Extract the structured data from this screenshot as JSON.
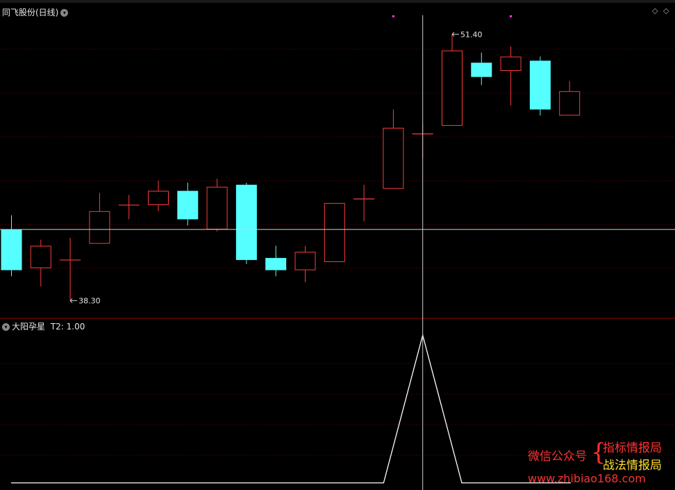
{
  "main_panel": {
    "title": "同飞股份(日线)",
    "diamond_icon": "◇"
  },
  "indicator_panel": {
    "name": "大阳孕星",
    "t2_label": "T2: 1.00"
  },
  "watermark": {
    "left_text": "微信公众号",
    "line1": "指标情报局",
    "line2": "战法情报局",
    "url": "www.zhibiao168.com"
  },
  "colors": {
    "up": "#ff3b3b",
    "down": "#55ffff",
    "grid": "#7a0000",
    "separator": "#a00000",
    "crosshair": "#cfcfcf",
    "line": "#ffffff",
    "marker": "#ff33ff",
    "watermark_red": "#ff3333",
    "watermark_yellow": "#ffdd33"
  },
  "chart_data": [
    {
      "type": "candlestick",
      "title": "同飞股份(日线)",
      "ylim": [
        37.5,
        52.4
      ],
      "grid": true,
      "annotations": [
        {
          "label": "38.30",
          "x": 4,
          "y": 38.3
        },
        {
          "label": "51.40",
          "x": 15,
          "y": 51.4
        }
      ],
      "candles": [
        {
          "x": 1,
          "open": 41.8,
          "high": 42.5,
          "low": 39.5,
          "close": 39.8
        },
        {
          "x": 2,
          "open": 39.9,
          "high": 41.3,
          "low": 39.0,
          "close": 41.0
        },
        {
          "x": 3,
          "open": 40.3,
          "high": 41.4,
          "low": 38.3,
          "close": 40.3
        },
        {
          "x": 4,
          "open": 41.1,
          "high": 43.6,
          "low": 41.1,
          "close": 42.7
        },
        {
          "x": 5,
          "open": 43.0,
          "high": 43.5,
          "low": 42.3,
          "close": 43.0
        },
        {
          "x": 6,
          "open": 43.0,
          "high": 44.2,
          "low": 42.7,
          "close": 43.7
        },
        {
          "x": 7,
          "open": 43.7,
          "high": 44.1,
          "low": 42.0,
          "close": 42.3
        },
        {
          "x": 8,
          "open": 41.8,
          "high": 44.3,
          "low": 41.7,
          "close": 43.9
        },
        {
          "x": 9,
          "open": 44.0,
          "high": 44.1,
          "low": 40.1,
          "close": 40.3
        },
        {
          "x": 10,
          "open": 40.4,
          "high": 41.0,
          "low": 39.5,
          "close": 39.8
        },
        {
          "x": 11,
          "open": 39.8,
          "high": 41.0,
          "low": 39.2,
          "close": 40.7
        },
        {
          "x": 12,
          "open": 40.2,
          "high": 43.1,
          "low": 40.2,
          "close": 43.1
        },
        {
          "x": 13,
          "open": 43.3,
          "high": 44.0,
          "low": 42.2,
          "close": 43.3
        },
        {
          "x": 14,
          "open": 43.8,
          "high": 47.7,
          "low": 43.8,
          "close": 46.8
        },
        {
          "x": 15,
          "open": 46.5,
          "high": 47.0,
          "low": 45.3,
          "close": 46.5
        },
        {
          "x": 16,
          "open": 46.9,
          "high": 51.4,
          "low": 46.9,
          "close": 50.6
        },
        {
          "x": 17,
          "open": 50.0,
          "high": 50.5,
          "low": 48.9,
          "close": 49.3
        },
        {
          "x": 18,
          "open": 49.6,
          "high": 50.8,
          "low": 47.9,
          "close": 50.3
        },
        {
          "x": 19,
          "open": 50.1,
          "high": 50.3,
          "low": 47.4,
          "close": 47.7
        },
        {
          "x": 20,
          "open": 47.4,
          "high": 49.1,
          "low": 47.4,
          "close": 48.6
        }
      ],
      "markers": [
        {
          "x": 14,
          "label": "·"
        },
        {
          "x": 18,
          "label": "·"
        }
      ]
    },
    {
      "type": "line",
      "title": "大阳孕星",
      "series": [
        {
          "name": "T2",
          "x": [
            0.5,
            14.0,
            15.0,
            16.0,
            20.5
          ],
          "values": [
            0,
            0,
            1,
            0,
            0
          ]
        }
      ],
      "ylim": [
        -0.02,
        1.02
      ],
      "current": {
        "x": 15,
        "T2": 1.0
      },
      "grid": true
    }
  ]
}
